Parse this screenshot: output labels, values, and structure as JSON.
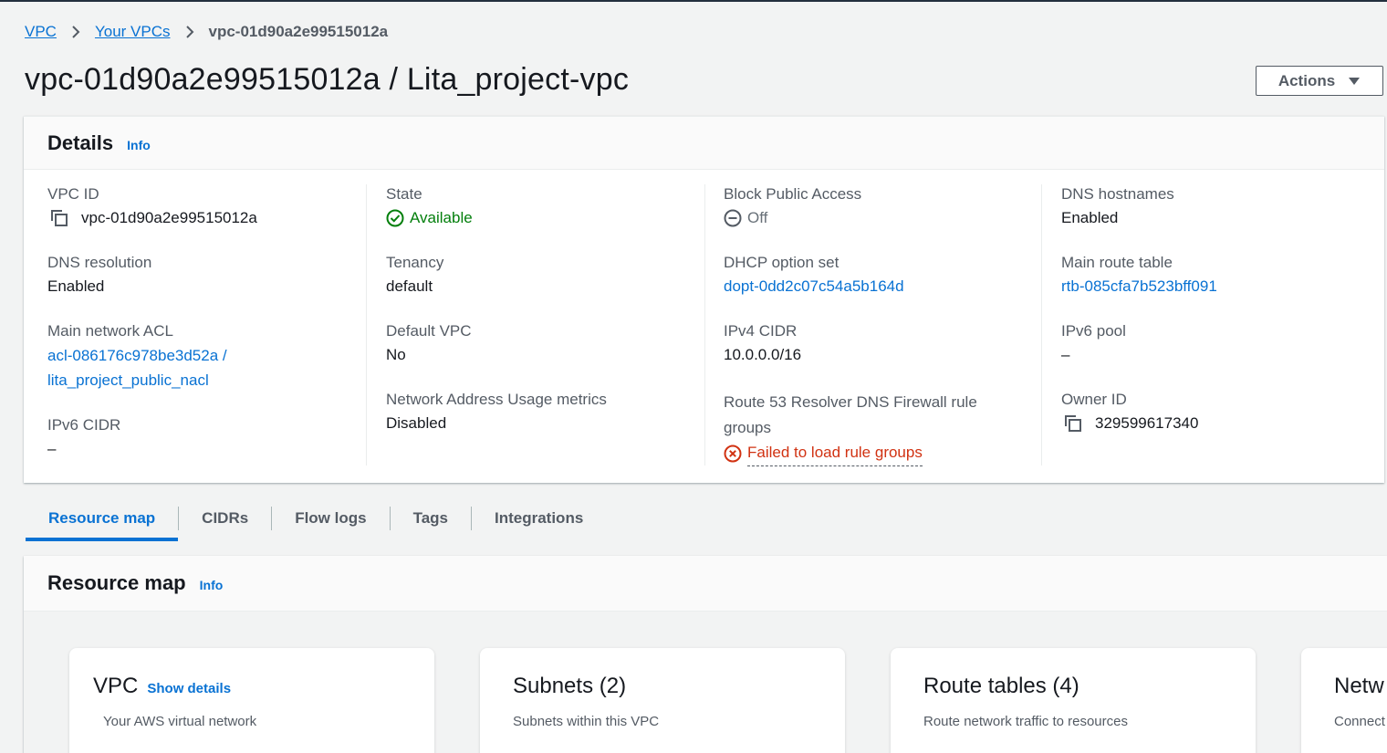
{
  "breadcrumb": {
    "items": [
      "VPC",
      "Your VPCs"
    ],
    "current": "vpc-01d90a2e99515012a"
  },
  "page_title": "vpc-01d90a2e99515012a / Lita_project-vpc",
  "actions": {
    "label": "Actions"
  },
  "details": {
    "title": "Details",
    "info": "Info",
    "fields": {
      "vpc_id": {
        "label": "VPC ID",
        "value": "vpc-01d90a2e99515012a"
      },
      "dns_resolution": {
        "label": "DNS resolution",
        "value": "Enabled"
      },
      "main_acl": {
        "label": "Main network ACL",
        "value_line1": "acl-086176c978be3d52a /",
        "value_line2": "lita_project_public_nacl"
      },
      "ipv6_cidr": {
        "label": "IPv6 CIDR",
        "value": "–"
      },
      "state": {
        "label": "State",
        "value": "Available"
      },
      "tenancy": {
        "label": "Tenancy",
        "value": "default"
      },
      "default_vpc": {
        "label": "Default VPC",
        "value": "No"
      },
      "nau_metrics": {
        "label": "Network Address Usage metrics",
        "value": "Disabled"
      },
      "block_public_access": {
        "label": "Block Public Access",
        "value": "Off"
      },
      "dhcp_option_set": {
        "label": "DHCP option set",
        "value": "dopt-0dd2c07c54a5b164d"
      },
      "ipv4_cidr": {
        "label": "IPv4 CIDR",
        "value": "10.0.0.0/16"
      },
      "dns_firewall": {
        "label_line1": "Route 53 Resolver DNS Firewall rule",
        "label_line2": "groups",
        "value": "Failed to load rule groups"
      },
      "dns_hostnames": {
        "label": "DNS hostnames",
        "value": "Enabled"
      },
      "main_route_table": {
        "label": "Main route table",
        "value": "rtb-085cfa7b523bff091"
      },
      "ipv6_pool": {
        "label": "IPv6 pool",
        "value": "–"
      },
      "owner_id": {
        "label": "Owner ID",
        "value": "329599617340"
      }
    }
  },
  "tabs": [
    "Resource map",
    "CIDRs",
    "Flow logs",
    "Tags",
    "Integrations"
  ],
  "active_tab": "Resource map",
  "resource_map": {
    "title": "Resource map",
    "info": "Info",
    "cards": [
      {
        "title": "VPC",
        "action": "Show details",
        "subtitle": "Your AWS virtual network"
      },
      {
        "title": "Subnets (2)",
        "subtitle": "Subnets within this VPC"
      },
      {
        "title": "Route tables (4)",
        "subtitle": "Route network traffic to resources"
      },
      {
        "title": "Netw",
        "subtitle": "Connect"
      }
    ]
  },
  "colors": {
    "link": "#0972d3",
    "success": "#037f0c",
    "error": "#d13212",
    "text": "#16191f",
    "muted": "#545b64"
  },
  "icons": [
    "chevron-right-icon",
    "caret-down-icon",
    "copy-icon",
    "check-circle-icon",
    "minus-circle-icon",
    "error-circle-icon"
  ]
}
